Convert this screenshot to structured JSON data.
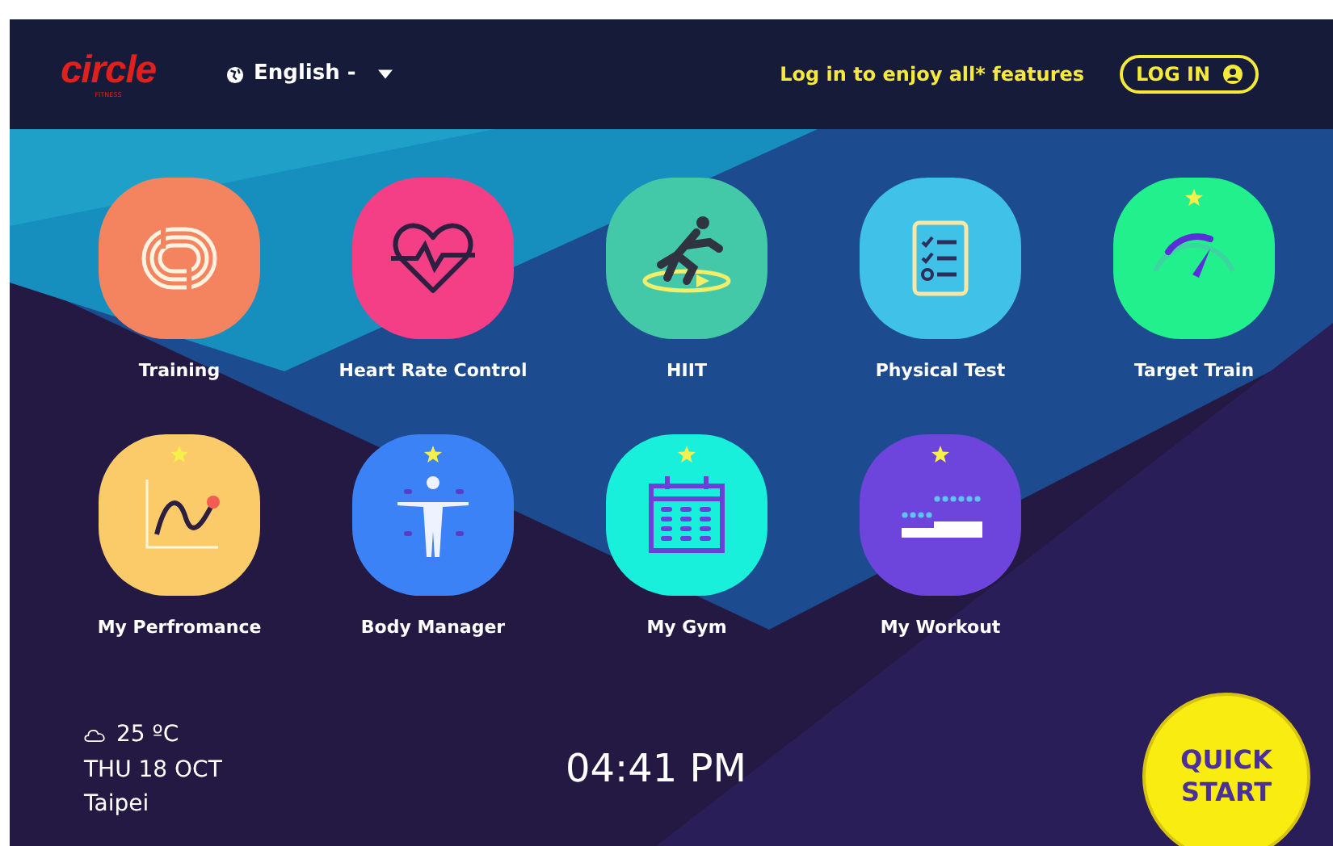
{
  "header": {
    "logo": "circle",
    "logo_tagline": "FITNESS",
    "language": "English -",
    "login_prompt": "Log in to enjoy all* features",
    "login_button": "LOG IN"
  },
  "apps": [
    {
      "label": "Training",
      "kind": "track",
      "color": "#f4845f",
      "starred": false
    },
    {
      "label": "Heart Rate Control",
      "kind": "heart",
      "color": "#f43f86",
      "starred": false
    },
    {
      "label": "HIIT",
      "kind": "runner",
      "color": "#44c9a8",
      "starred": false
    },
    {
      "label": "Physical Test",
      "kind": "checklist",
      "color": "#3fc1e8",
      "starred": false
    },
    {
      "label": "Target Train",
      "kind": "gauge",
      "color": "#22f08c",
      "starred": true
    },
    {
      "label": "My Perfromance",
      "kind": "graph",
      "color": "#fbcb6a",
      "starred": true
    },
    {
      "label": "Body Manager",
      "kind": "body",
      "color": "#3b82f6",
      "starred": true
    },
    {
      "label": "My Gym",
      "kind": "calendar",
      "color": "#19f0dc",
      "starred": true
    },
    {
      "label": "My Workout",
      "kind": "steps",
      "color": "#6d44dc",
      "starred": true
    }
  ],
  "footer": {
    "temperature": "25 ºC",
    "date": "THU 18 OCT",
    "city": "Taipei",
    "time": "04:41 PM",
    "quick_start": "QUICK START"
  }
}
